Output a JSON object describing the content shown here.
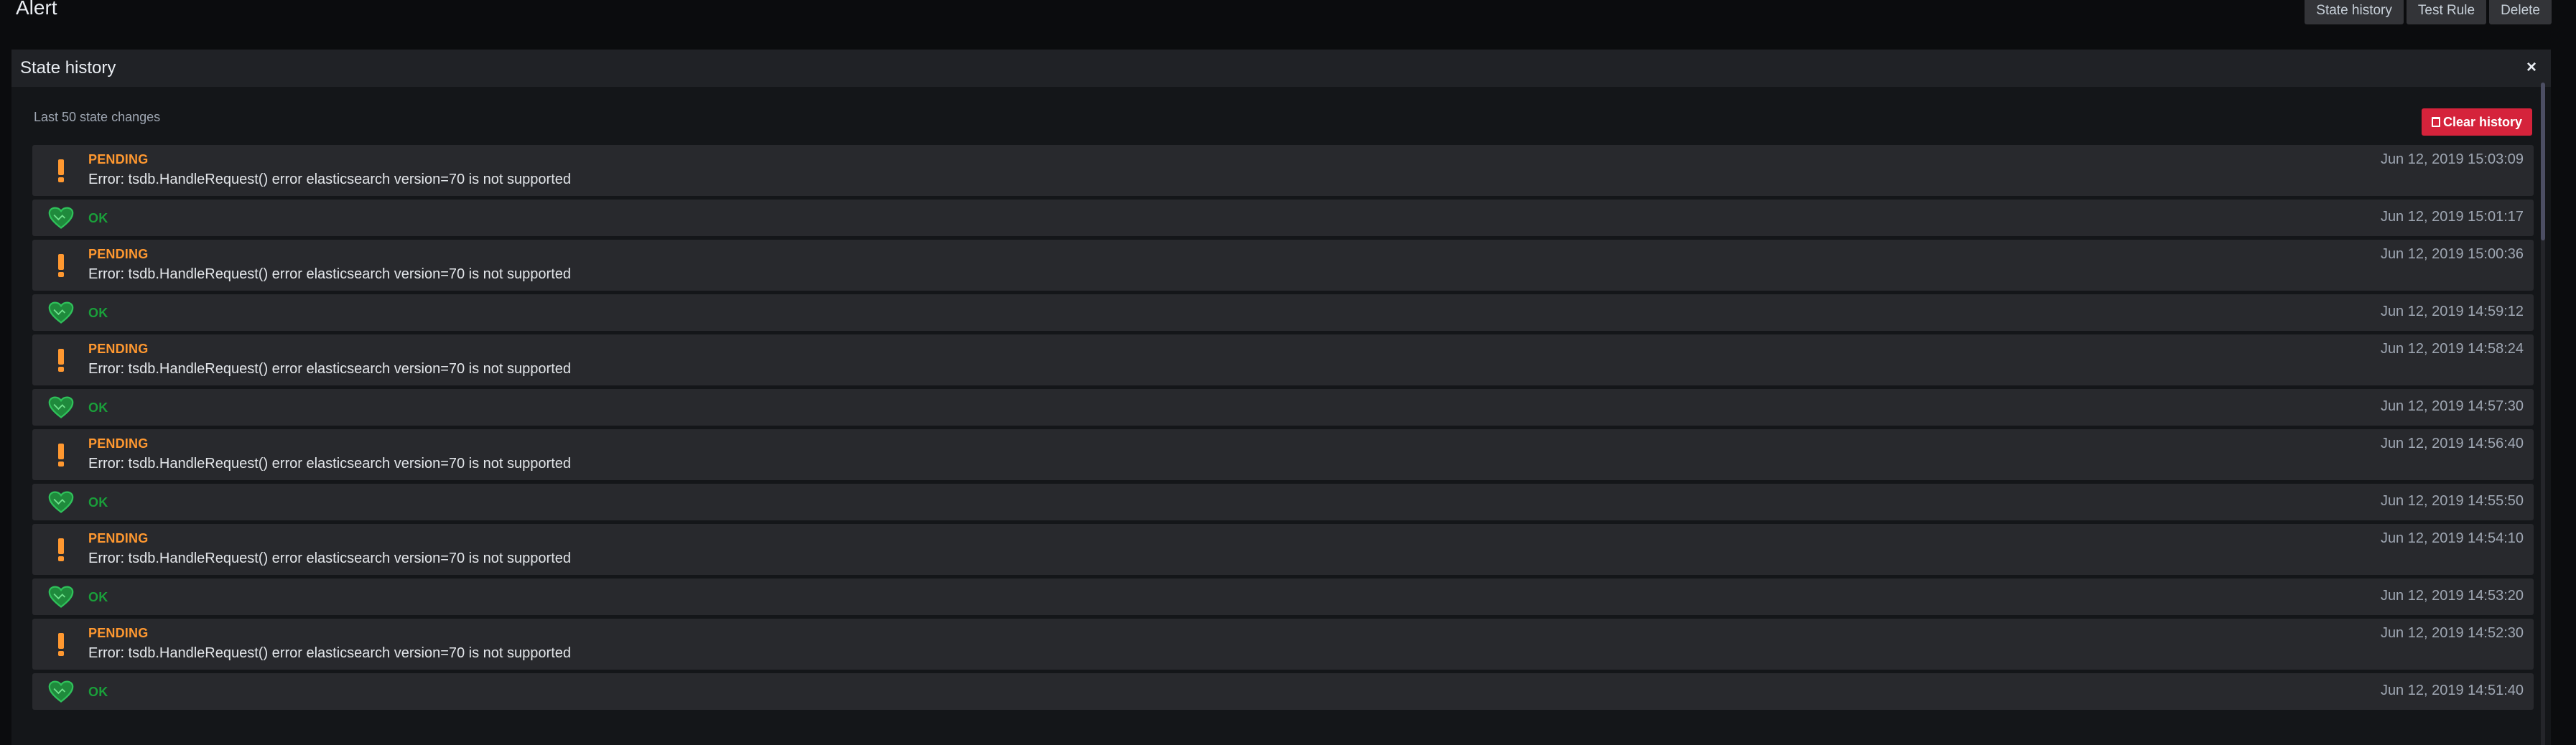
{
  "header": {
    "title": "Alert",
    "actions": [
      "State history",
      "Test Rule",
      "Delete"
    ]
  },
  "drawer": {
    "title": "State history",
    "close_label": "×",
    "subtitle": "Last 50 state changes",
    "clear_button": "Clear history"
  },
  "icons": {
    "pending": "exclamation-icon",
    "ok": "heart-icon",
    "clear": "trash-icon",
    "close": "close-icon"
  },
  "colors": {
    "pending": "#ff9830",
    "ok": "#1a9f3a",
    "danger": "#d5233b"
  },
  "history": [
    {
      "state": "PENDING",
      "status": "pending",
      "message": "Error: tsdb.HandleRequest() error elasticsearch version=70 is not supported",
      "time": "Jun 12, 2019 15:03:09"
    },
    {
      "state": "OK",
      "status": "ok",
      "message": "",
      "time": "Jun 12, 2019 15:01:17"
    },
    {
      "state": "PENDING",
      "status": "pending",
      "message": "Error: tsdb.HandleRequest() error elasticsearch version=70 is not supported",
      "time": "Jun 12, 2019 15:00:36"
    },
    {
      "state": "OK",
      "status": "ok",
      "message": "",
      "time": "Jun 12, 2019 14:59:12"
    },
    {
      "state": "PENDING",
      "status": "pending",
      "message": "Error: tsdb.HandleRequest() error elasticsearch version=70 is not supported",
      "time": "Jun 12, 2019 14:58:24"
    },
    {
      "state": "OK",
      "status": "ok",
      "message": "",
      "time": "Jun 12, 2019 14:57:30"
    },
    {
      "state": "PENDING",
      "status": "pending",
      "message": "Error: tsdb.HandleRequest() error elasticsearch version=70 is not supported",
      "time": "Jun 12, 2019 14:56:40"
    },
    {
      "state": "OK",
      "status": "ok",
      "message": "",
      "time": "Jun 12, 2019 14:55:50"
    },
    {
      "state": "PENDING",
      "status": "pending",
      "message": "Error: tsdb.HandleRequest() error elasticsearch version=70 is not supported",
      "time": "Jun 12, 2019 14:54:10"
    },
    {
      "state": "OK",
      "status": "ok",
      "message": "",
      "time": "Jun 12, 2019 14:53:20"
    },
    {
      "state": "PENDING",
      "status": "pending",
      "message": "Error: tsdb.HandleRequest() error elasticsearch version=70 is not supported",
      "time": "Jun 12, 2019 14:52:30"
    },
    {
      "state": "OK",
      "status": "ok",
      "message": "",
      "time": "Jun 12, 2019 14:51:40"
    }
  ]
}
